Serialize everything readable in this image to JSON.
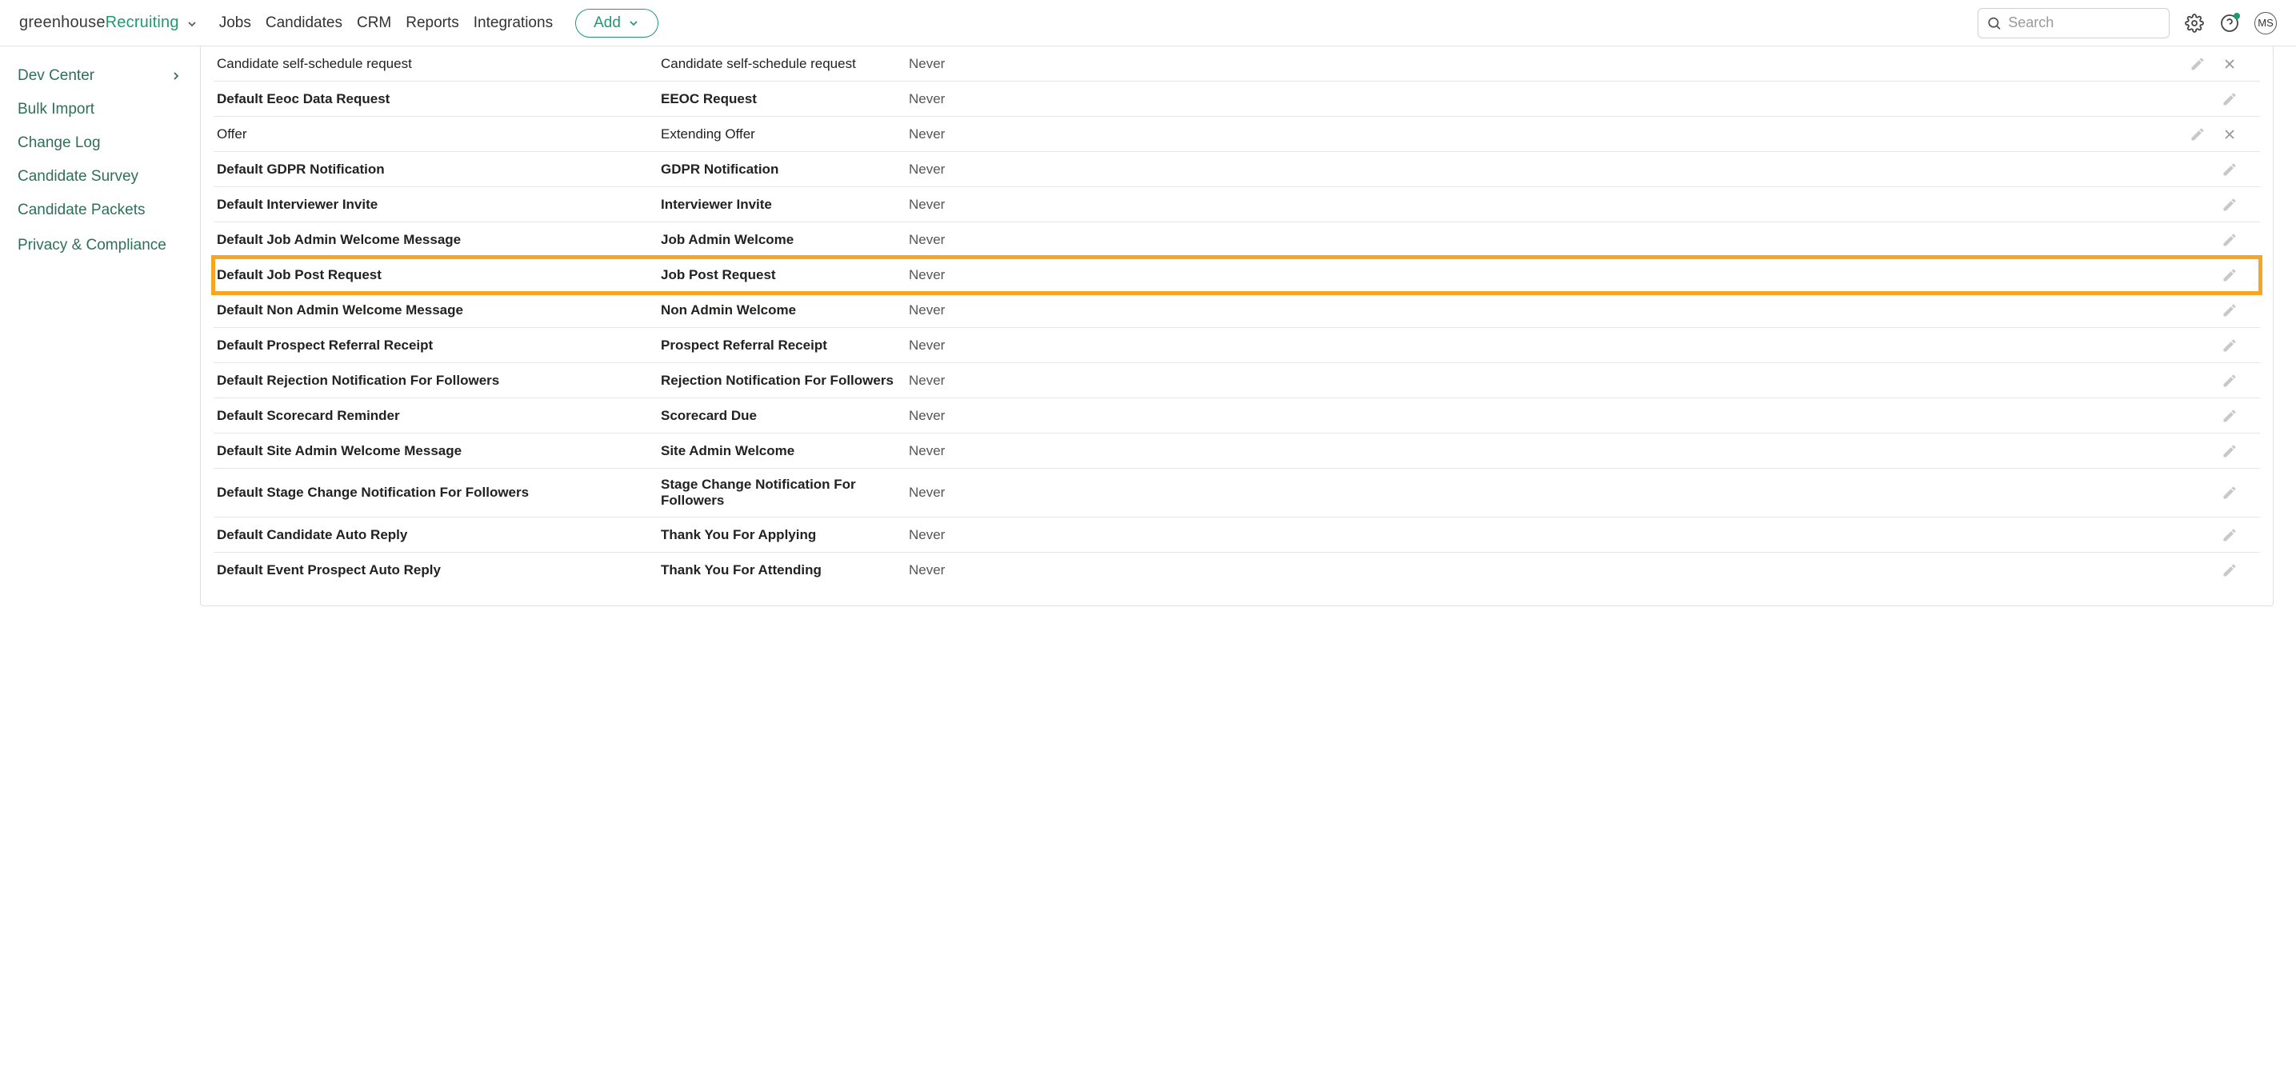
{
  "header": {
    "logo_part1": "greenhouse",
    "logo_part2": "Recruiting",
    "nav": [
      "Jobs",
      "Candidates",
      "CRM",
      "Reports",
      "Integrations"
    ],
    "add_label": "Add",
    "search_placeholder": "Search",
    "avatar_initials": "MS"
  },
  "sidebar": {
    "items": [
      {
        "label": "Dev Center",
        "expandable": true
      },
      {
        "label": "Bulk Import",
        "expandable": false
      },
      {
        "label": "Change Log",
        "expandable": false
      },
      {
        "label": "Candidate Survey",
        "expandable": false
      },
      {
        "label": "Candidate Packets",
        "expandable": false
      },
      {
        "label": "Privacy & Compliance",
        "expandable": false
      }
    ]
  },
  "table": {
    "rows": [
      {
        "name": "Candidate self-schedule request",
        "type": "Candidate self-schedule request",
        "when": "Never",
        "bold": false,
        "deletable": true,
        "highlight": false
      },
      {
        "name": "Default Eeoc Data Request",
        "type": "EEOC Request",
        "when": "Never",
        "bold": true,
        "deletable": false,
        "highlight": false
      },
      {
        "name": "Offer",
        "type": "Extending Offer",
        "when": "Never",
        "bold": false,
        "deletable": true,
        "highlight": false
      },
      {
        "name": "Default GDPR Notification",
        "type": "GDPR Notification",
        "when": "Never",
        "bold": true,
        "deletable": false,
        "highlight": false
      },
      {
        "name": "Default Interviewer Invite",
        "type": "Interviewer Invite",
        "when": "Never",
        "bold": true,
        "deletable": false,
        "highlight": false
      },
      {
        "name": "Default Job Admin Welcome Message",
        "type": "Job Admin Welcome",
        "when": "Never",
        "bold": true,
        "deletable": false,
        "highlight": false
      },
      {
        "name": "Default Job Post Request",
        "type": "Job Post Request",
        "when": "Never",
        "bold": true,
        "deletable": false,
        "highlight": true
      },
      {
        "name": "Default Non Admin Welcome Message",
        "type": "Non Admin Welcome",
        "when": "Never",
        "bold": true,
        "deletable": false,
        "highlight": false
      },
      {
        "name": "Default Prospect Referral Receipt",
        "type": "Prospect Referral Receipt",
        "when": "Never",
        "bold": true,
        "deletable": false,
        "highlight": false
      },
      {
        "name": "Default Rejection Notification For Followers",
        "type": "Rejection Notification For Followers",
        "when": "Never",
        "bold": true,
        "deletable": false,
        "highlight": false
      },
      {
        "name": "Default Scorecard Reminder",
        "type": "Scorecard Due",
        "when": "Never",
        "bold": true,
        "deletable": false,
        "highlight": false
      },
      {
        "name": "Default Site Admin Welcome Message",
        "type": "Site Admin Welcome",
        "when": "Never",
        "bold": true,
        "deletable": false,
        "highlight": false
      },
      {
        "name": "Default Stage Change Notification For Followers",
        "type": "Stage Change Notification For Followers",
        "when": "Never",
        "bold": true,
        "deletable": false,
        "highlight": false
      },
      {
        "name": "Default Candidate Auto Reply",
        "type": "Thank You For Applying",
        "when": "Never",
        "bold": true,
        "deletable": false,
        "highlight": false
      },
      {
        "name": "Default Event Prospect Auto Reply",
        "type": "Thank You For Attending",
        "when": "Never",
        "bold": true,
        "deletable": false,
        "highlight": false
      }
    ]
  }
}
